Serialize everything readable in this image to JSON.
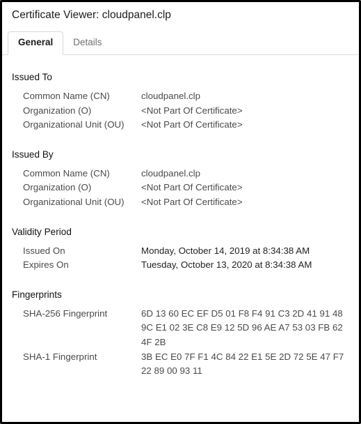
{
  "window": {
    "title": "Certificate Viewer: cloudpanel.clp"
  },
  "tabs": {
    "general": "General",
    "details": "Details"
  },
  "issued_to": {
    "heading": "Issued To",
    "cn_label": "Common Name (CN)",
    "cn_value": "cloudpanel.clp",
    "o_label": "Organization (O)",
    "o_value": "<Not Part Of Certificate>",
    "ou_label": "Organizational Unit (OU)",
    "ou_value": "<Not Part Of Certificate>"
  },
  "issued_by": {
    "heading": "Issued By",
    "cn_label": "Common Name (CN)",
    "cn_value": "cloudpanel.clp",
    "o_label": "Organization (O)",
    "o_value": "<Not Part Of Certificate>",
    "ou_label": "Organizational Unit (OU)",
    "ou_value": "<Not Part Of Certificate>"
  },
  "validity": {
    "heading": "Validity Period",
    "issued_label": "Issued On",
    "issued_value": "Monday, October 14, 2019 at 8:34:38 AM",
    "expires_label": "Expires On",
    "expires_value": "Tuesday, October 13, 2020 at 8:34:38 AM"
  },
  "fingerprints": {
    "heading": "Fingerprints",
    "sha256_label": "SHA-256 Fingerprint",
    "sha256_value": "6D 13 60 EC EF D5 01 F8 F4 91 C3 2D 41 91 48 9C E1 02 3E C8 E9 12 5D 96 AE A7 53 03 FB 62 4F 2B",
    "sha1_label": "SHA-1 Fingerprint",
    "sha1_value": "3B EC E0 7F F1 4C 84 22 E1 5E 2D 72 5E 47 F7 22 89 00 93 11"
  }
}
